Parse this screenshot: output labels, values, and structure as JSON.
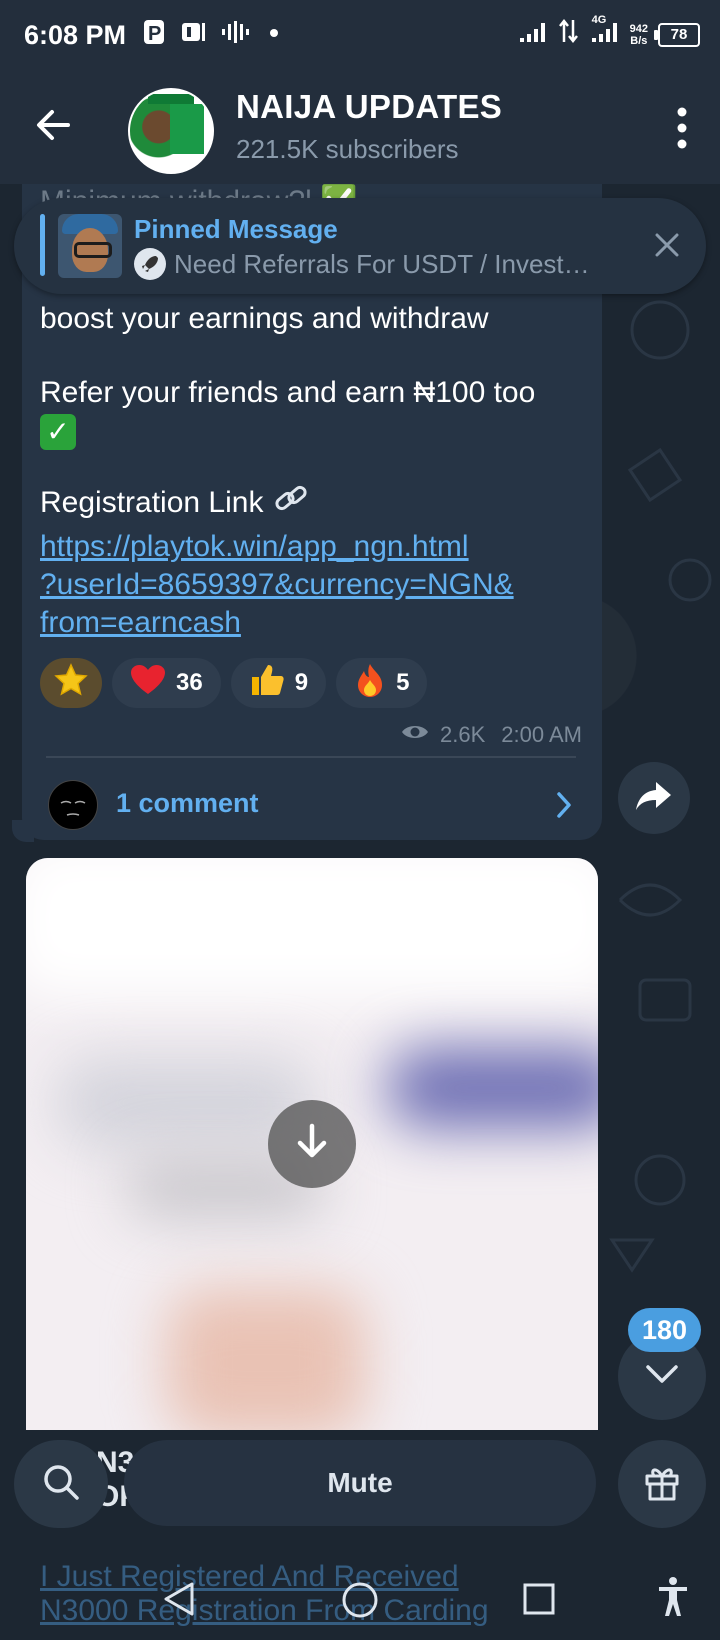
{
  "status_bar": {
    "time": "6:08 PM",
    "net_speed_value": "942",
    "net_speed_unit": "B/s",
    "battery": "78",
    "signal_label": "4G"
  },
  "header": {
    "title": "NAIJA UPDATES",
    "subtitle": "221.5K subscribers"
  },
  "pinned": {
    "title": "Pinned Message",
    "text": "Need Referrals For USDT / Invest…"
  },
  "message": {
    "faded_top": "Minimum withdraw?l ✅",
    "line1": "boost your earnings and withdraw",
    "line2": "Refer your friends and earn ₦100 too",
    "line3": "Registration Link",
    "link_line1": "https://playtok.win/app_ngn.html",
    "link_line2": "?userId=8659397&currency=NGN&",
    "link_line3": "from=earncash",
    "reactions": [
      {
        "emoji": "star",
        "count": ""
      },
      {
        "emoji": "heart",
        "count": "36"
      },
      {
        "emoji": "thumbs-up",
        "count": "9"
      },
      {
        "emoji": "fire",
        "count": "5"
      }
    ],
    "views": "2.6K",
    "time": "2:00 AM",
    "comments": "1 comment"
  },
  "scroll": {
    "unread_count": "180"
  },
  "bottom": {
    "under_text_1": "N3",
    "under_text_2": "OPI",
    "mute_label": "Mute",
    "faded_link_1": "I Just Registered And Received",
    "faded_link_2": "N3000 Registration From Carding"
  },
  "colors": {
    "accent": "#62b0f0",
    "bubble": "#263445",
    "background": "#1c2631",
    "badge": "#4a9ee0"
  }
}
